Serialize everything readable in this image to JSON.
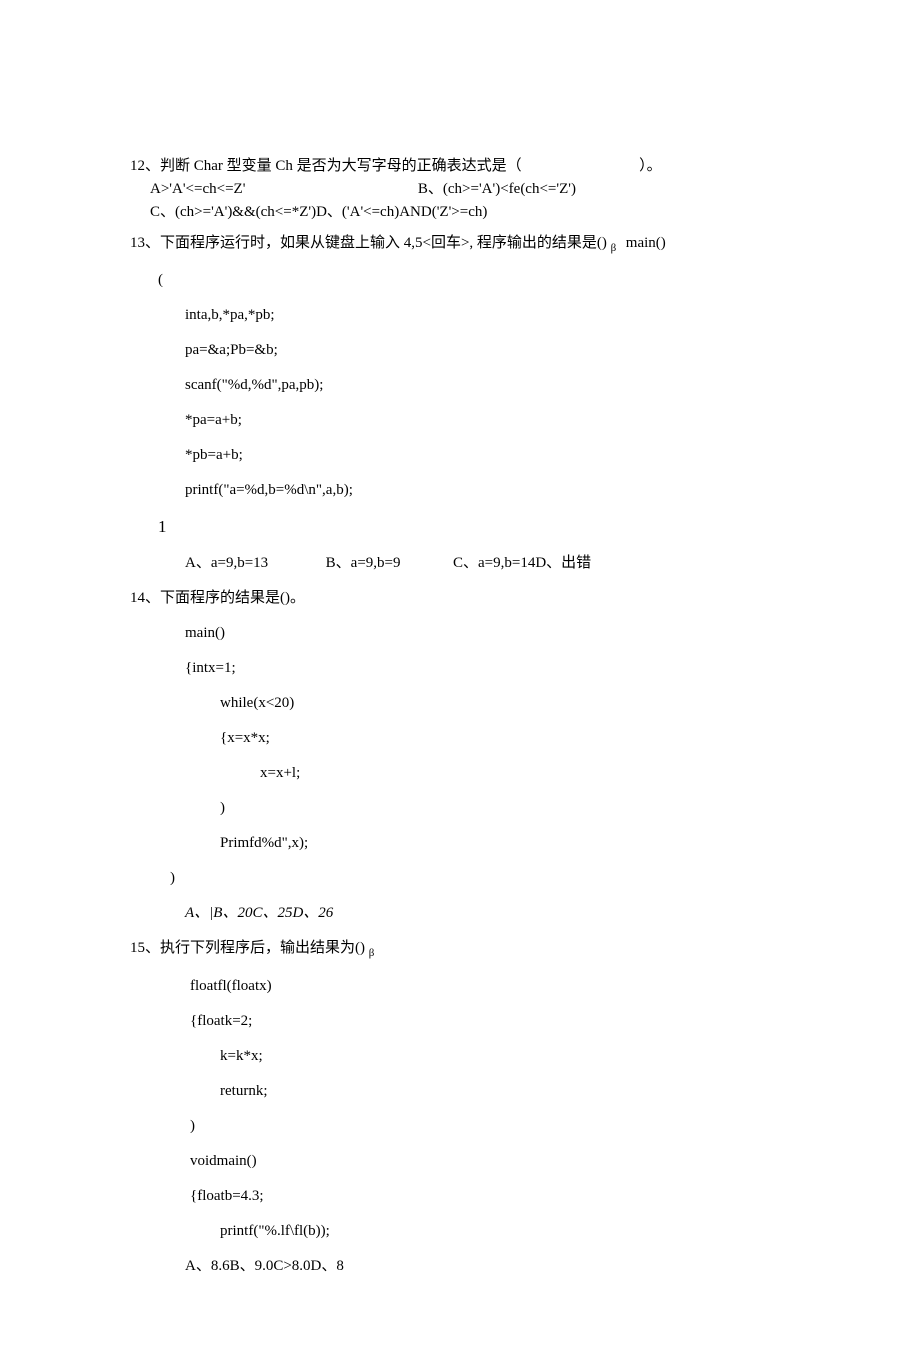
{
  "q12": {
    "head": "12、判断 Char 型变量 Ch 是否为大写字母的正确表达式是（",
    "head_tail": "）。",
    "a": "A>'A'<=ch<=Z'",
    "b": "B、(ch>='A')<fe(ch<='Z')",
    "c": "C、(ch>='A')&&(ch<=*Z')D、('A'<=ch)AND('Z'>=ch)"
  },
  "q13": {
    "head_a": "13、下面程序运行时，如果从键盘上输入 4,5<回车>, 程序输出的结果是()",
    "head_b": "main()",
    "brace_open": "(",
    "c1": "inta,b,*pa,*pb;",
    "c2": "pa=&a;Pb=&b;",
    "c3": "scanf(\"%d,%d\",pa,pb);",
    "c4": "*pa=a+b;",
    "c5": "*pb=a+b;",
    "c6": "printf(\"a=%d,b=%d\\n\",a,b);",
    "brace_close": "1",
    "ans_a": "A、a=9,b=13",
    "ans_b": "B、a=9,b=9",
    "ans_c": "C、a=9,b=14D、出错"
  },
  "q14": {
    "head": "14、下面程序的结果是()。",
    "c1": "main()",
    "c2": "{intx=1;",
    "c3": "while(x<20)",
    "c4": "{x=x*x;",
    "c5": "x=x+l;",
    "c6": ")",
    "c7": "Primfd%d\",x);",
    "c8": ")",
    "ans": "A、|B、20C、25D、26"
  },
  "q15": {
    "head_a": "15、执行下列程序后，输出结果为()",
    "c1": "floatfl(floatx)",
    "c2": "{floatk=2;",
    "c3": "k=k*x;",
    "c4": "returnk;",
    "c5": ")",
    "c6": "voidmain()",
    "c7": "{floatb=4.3;",
    "c8": "printf(\"%.lf\\fl(b));",
    "ans": "A、8.6B、9.0C>8.0D、8"
  },
  "beta": "β"
}
